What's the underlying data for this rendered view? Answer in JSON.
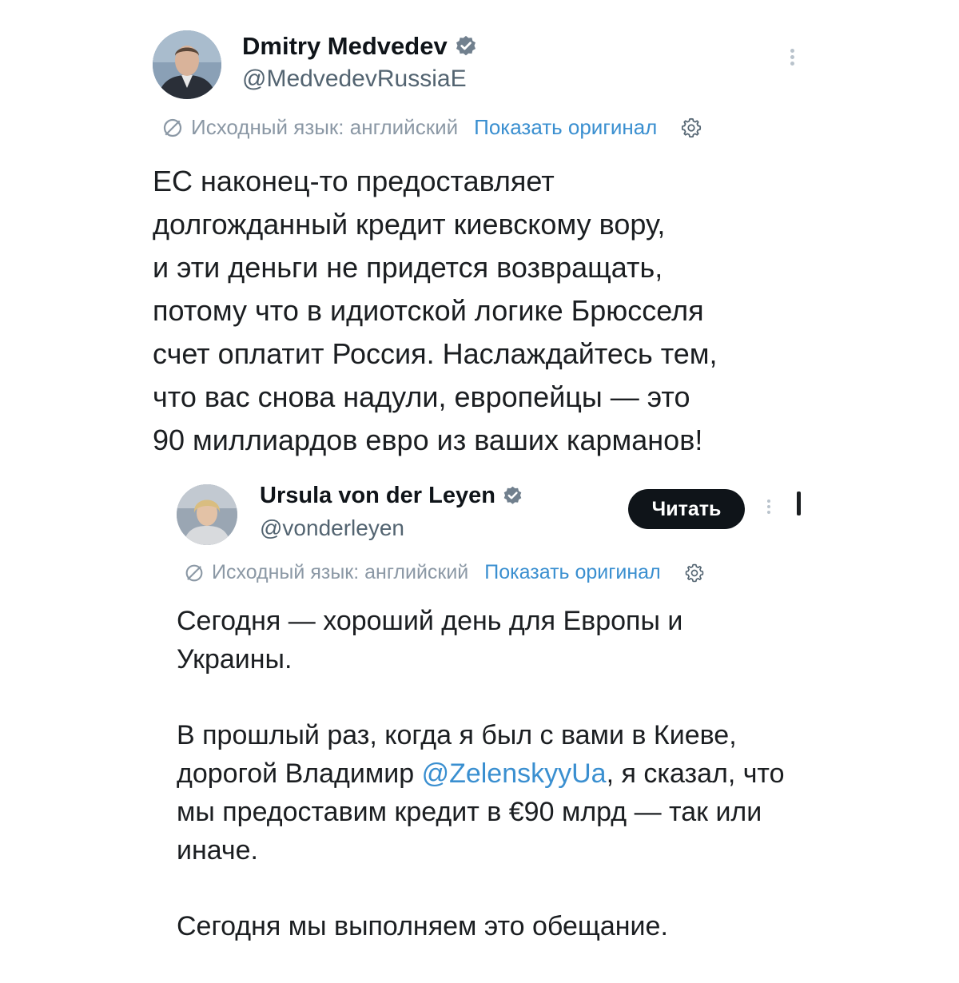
{
  "main_tweet": {
    "display_name": "Dmitry Medvedev",
    "handle": "@MedvedevRussiaE",
    "translation_label": "Исходный язык: английский",
    "show_original_label": "Показать оригинал",
    "body_text": "ЕС наконец-то предоставляет\nдолгожданный кредит киевскому вору,\nи эти деньги не придется возвращать,\nпотому что в идиотской логике Брюсселя\nсчет оплатит Россия. Наслаждайтесь тем,\nчто вас снова надули, европейцы — это\n90 миллиардов евро из ваших карманов!"
  },
  "quoted_tweet": {
    "display_name": "Ursula von der Leyen",
    "handle": "@vonderleyen",
    "follow_label": "Читать",
    "translation_label": "Исходный язык: английский",
    "show_original_label": "Показать оригинал",
    "paragraph_1": "Сегодня — хороший день для Европы и Украины.",
    "paragraph_2_before": "В прошлый раз, когда я был с вами в Киеве, дорогой Владимир ",
    "paragraph_2_mention": "@ZelenskyyUa",
    "paragraph_2_after": ", я сказал, что мы предоставим кредит в €90 млрд — так или иначе.",
    "paragraph_3": "Сегодня мы выполняем это обещание."
  },
  "icons": {
    "verified": "verified-badge-icon",
    "translate": "translate-icon",
    "settings": "gear-icon",
    "more": "more-options-icon"
  },
  "colors": {
    "link": "#3a8fd0",
    "secondary_text": "#536471",
    "button_bg": "#0f1419"
  }
}
